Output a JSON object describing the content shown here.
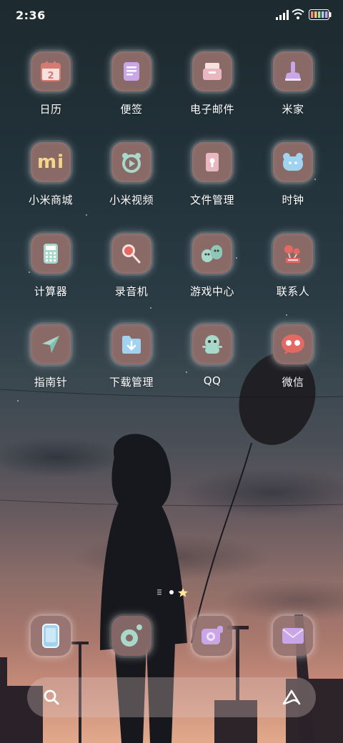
{
  "status_bar": {
    "time": "2:36"
  },
  "apps": [
    {
      "label": "日历",
      "icon": "calendar-icon",
      "day": "2"
    },
    {
      "label": "便签",
      "icon": "notes-icon"
    },
    {
      "label": "电子邮件",
      "icon": "email-icon"
    },
    {
      "label": "米家",
      "icon": "mijia-icon"
    },
    {
      "label": "小米商城",
      "icon": "mi-store-icon",
      "logo": "mi"
    },
    {
      "label": "小米视频",
      "icon": "video-icon"
    },
    {
      "label": "文件管理",
      "icon": "file-manager-icon"
    },
    {
      "label": "时钟",
      "icon": "clock-icon"
    },
    {
      "label": "计算器",
      "icon": "calculator-icon"
    },
    {
      "label": "录音机",
      "icon": "recorder-icon"
    },
    {
      "label": "游戏中心",
      "icon": "game-center-icon"
    },
    {
      "label": "联系人",
      "icon": "contacts-icon"
    },
    {
      "label": "指南针",
      "icon": "compass-icon"
    },
    {
      "label": "下载管理",
      "icon": "download-icon"
    },
    {
      "label": "QQ",
      "icon": "qq-icon"
    },
    {
      "label": "微信",
      "icon": "wechat-icon"
    }
  ],
  "dock": [
    {
      "icon": "phone-icon"
    },
    {
      "icon": "music-icon"
    },
    {
      "icon": "camera-icon"
    },
    {
      "icon": "messages-icon"
    }
  ],
  "search_bar": {
    "left_icon": "search-icon",
    "right_icon": "assistant-icon"
  },
  "colors": {
    "tile": "#8a6a67",
    "accent_blue": "#9fd3ef",
    "accent_pink": "#e9b7c0",
    "accent_purple": "#c9a6e8"
  }
}
